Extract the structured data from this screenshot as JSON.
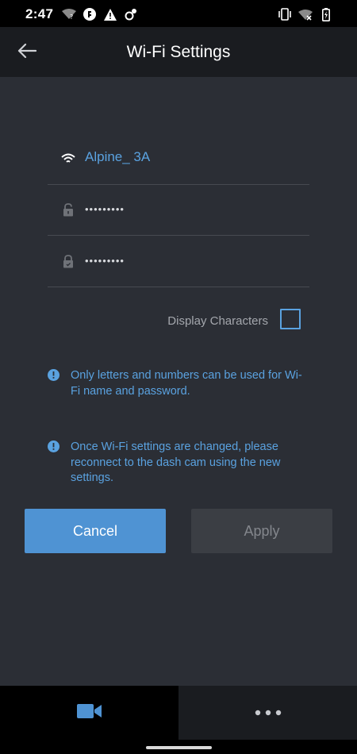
{
  "status_bar": {
    "time": "2:47",
    "left_icons": [
      "wifi-question-icon",
      "app-badge-icon",
      "warning-icon",
      "settings-sync-icon"
    ],
    "right_icons": [
      "vibrate-icon",
      "wifi-off-icon",
      "battery-charging-icon"
    ]
  },
  "app_bar": {
    "title": "Wi-Fi Settings",
    "back_icon": "arrow-left-icon"
  },
  "form": {
    "ssid": {
      "icon": "wifi-icon",
      "value": "Alpine_ 3A"
    },
    "password": {
      "icon": "lock-icon",
      "value": "•••••••••"
    },
    "confirm_password": {
      "icon": "lock-confirm-icon",
      "value": "•••••••••"
    },
    "display_characters": {
      "label": "Display Characters",
      "checked": false
    }
  },
  "notices": [
    {
      "icon": "info-icon",
      "text": "Only letters and numbers can be used for Wi-Fi name and password."
    },
    {
      "icon": "info-icon",
      "text": "Once Wi-Fi settings are changed, please reconnect to the dash cam using the new settings."
    }
  ],
  "buttons": {
    "cancel": "Cancel",
    "apply": "Apply"
  },
  "bottom_nav": {
    "items": [
      {
        "icon": "video-camera-icon",
        "active": true
      },
      {
        "icon": "more-dots-icon",
        "active": false
      }
    ]
  },
  "colors": {
    "accent": "#5aa2e0",
    "primary_button": "#4f93d3",
    "background": "#2b2e35",
    "app_bar": "#1a1c20"
  }
}
